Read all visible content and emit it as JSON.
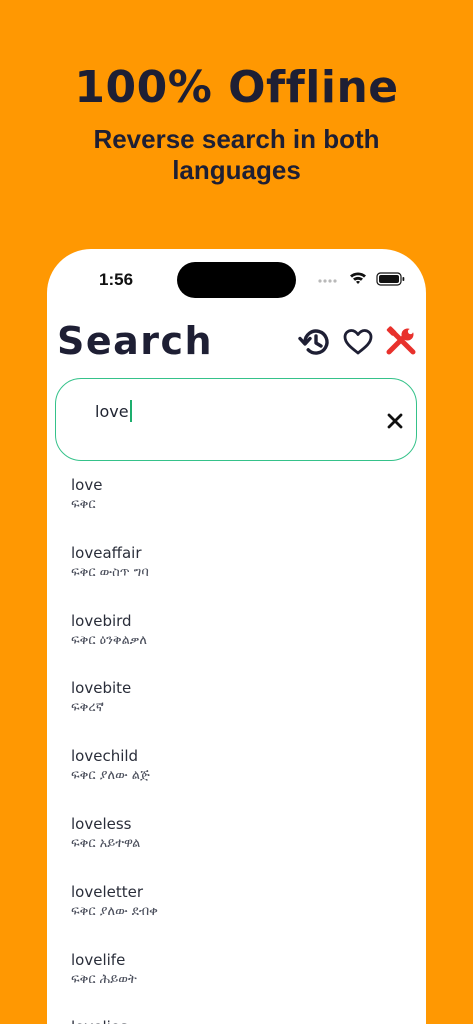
{
  "promo": {
    "title": "100% Offline",
    "subtitle": "Reverse search in both languages"
  },
  "status_bar": {
    "time": "1:56",
    "icons": [
      "cellular-signal-icon",
      "wifi-icon",
      "battery-icon"
    ]
  },
  "header": {
    "title": "Search",
    "icons": [
      "history-icon",
      "heart-icon",
      "tools-icon"
    ],
    "accent_color": "#E8312C"
  },
  "search": {
    "value": "love",
    "border_color": "#35C28A"
  },
  "results": [
    {
      "en": "love",
      "am": "ፍቅር"
    },
    {
      "en": "loveaffair",
      "am": "ፍቅር ውስጥ ግባ"
    },
    {
      "en": "lovebird",
      "am": "ፍቅር ዕንቅልቃለ"
    },
    {
      "en": "lovebite",
      "am": "ፍቅረኛ"
    },
    {
      "en": "lovechild",
      "am": "ፍቅር ያለው ልጅ"
    },
    {
      "en": "loveless",
      "am": "ፍቅር አይተዋል"
    },
    {
      "en": "loveletter",
      "am": "ፍቅር ያለው ደብቀ"
    },
    {
      "en": "lovelife",
      "am": "ፍቅር ሕይወት"
    },
    {
      "en": "lovelies",
      "am": ""
    }
  ],
  "colors": {
    "background": "#FF9802",
    "text_dark": "#1E1F34"
  }
}
